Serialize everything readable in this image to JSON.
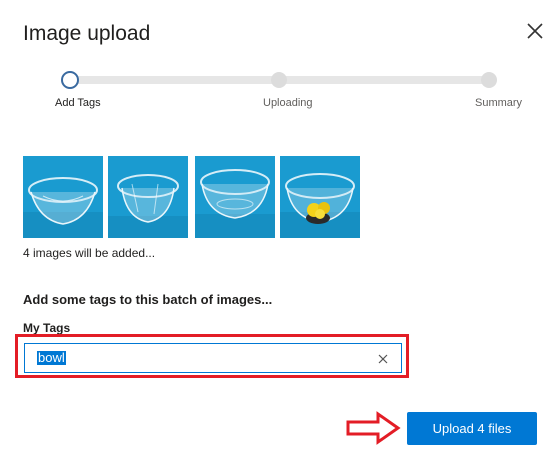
{
  "dialog": {
    "title": "Image upload"
  },
  "steps": [
    {
      "label": "Add Tags",
      "active": true
    },
    {
      "label": "Uploading",
      "active": false
    },
    {
      "label": "Summary",
      "active": false
    }
  ],
  "images": {
    "thumbnails": [
      "glass-bowl-image",
      "glass-bowl-image",
      "glass-bowl-image",
      "glass-bowl-with-fruit-image"
    ],
    "count_text": "4 images will be added..."
  },
  "tags": {
    "section_title": "Add some tags to this batch of images...",
    "field_label": "My Tags",
    "value": "bowl"
  },
  "actions": {
    "upload_label": "Upload 4 files"
  },
  "colors": {
    "accent": "#0078d4",
    "annotation": "#e31d26",
    "thumbnail_background": "#1a9bd0"
  }
}
